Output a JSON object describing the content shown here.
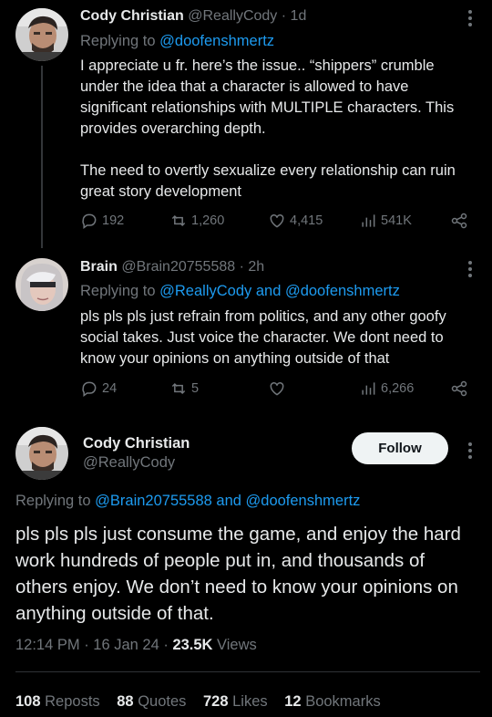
{
  "tweets": [
    {
      "name": "Cody Christian",
      "handle": "@ReallyCody",
      "time": "· 1d",
      "replying_prefix": "Replying to ",
      "replying_to": "@doofenshmertz",
      "text_p1": "I appreciate u fr. here’s the issue.. “shippers” crumble under the idea that a character is allowed to have significant relationships with MULTIPLE characters. This provides overarching depth.",
      "text_p2": "The need to overtly sexualize every relationship can ruin great story development",
      "replies": "192",
      "reposts": "1,260",
      "likes": "4,415",
      "views": "541K"
    },
    {
      "name": "Brain",
      "handle": "@Brain20755588",
      "time": "· 2h",
      "replying_prefix": "Replying to ",
      "replying_to": "@ReallyCody and @doofenshmertz",
      "text_p1": "pls pls pls just refrain from politics, and any other goofy social takes. Just voice the character. We dont need to know your opinions on anything outside of that",
      "replies": "24",
      "reposts": "5",
      "likes": "",
      "views": "6,266"
    }
  ],
  "main": {
    "name": "Cody Christian",
    "handle": "@ReallyCody",
    "follow_label": "Follow",
    "replying_prefix": "Replying to ",
    "replying_to": "@Brain20755588 and @doofenshmertz",
    "text": "pls pls pls just consume the game, and enjoy the hard work hundreds of people put in, and thousands of others enjoy. We don’t need to know your opinions on anything outside of that.",
    "time": "12:14 PM · 16 Jan 24 · ",
    "views_count": "23.5K",
    "views_label": " Views",
    "stats": [
      {
        "num": "108",
        "label": "Reposts"
      },
      {
        "num": "88",
        "label": "Quotes"
      },
      {
        "num": "728",
        "label": "Likes"
      },
      {
        "num": "12",
        "label": "Bookmarks"
      }
    ]
  },
  "colors": {
    "background": "#000000",
    "link": "#1d9bf0",
    "muted": "#71767b",
    "text": "#e7e9ea"
  }
}
